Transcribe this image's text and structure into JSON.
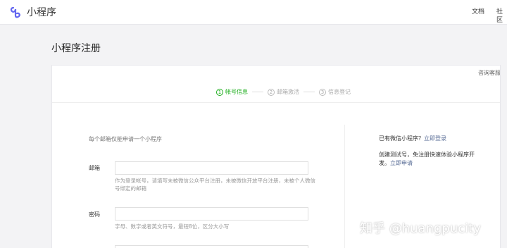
{
  "header": {
    "logo_text": "小程序",
    "nav": [
      "文档",
      "社区"
    ]
  },
  "page": {
    "title": "小程序注册"
  },
  "card": {
    "help_link": "咨询客服",
    "steps": [
      {
        "num": "①",
        "label": "帐号信息",
        "active": true
      },
      {
        "num": "②",
        "label": "邮箱激活",
        "active": false
      },
      {
        "num": "③",
        "label": "信息登记",
        "active": false
      }
    ]
  },
  "form": {
    "note": "每个邮箱仅能申请一个小程序",
    "email": {
      "label": "邮箱",
      "value": "",
      "tip": "作为登录帐号，请填写未被微信公众平台注册，未被微信开放平台注册，未被个人微信号绑定的邮箱"
    },
    "password": {
      "label": "密码",
      "value": "",
      "tip": "字母、数字或者英文符号，最短8位，区分大小写"
    }
  },
  "sidebar": {
    "have_account": "已有微信小程序？",
    "login_link": "立即登录",
    "test_desc": "创建测试号，免注册快速体验小程序开发。",
    "apply_link": "立即申请"
  },
  "watermark": "知乎 @huangpucity",
  "colors": {
    "accent_green": "#1aad19",
    "link_blue": "#576b95"
  }
}
